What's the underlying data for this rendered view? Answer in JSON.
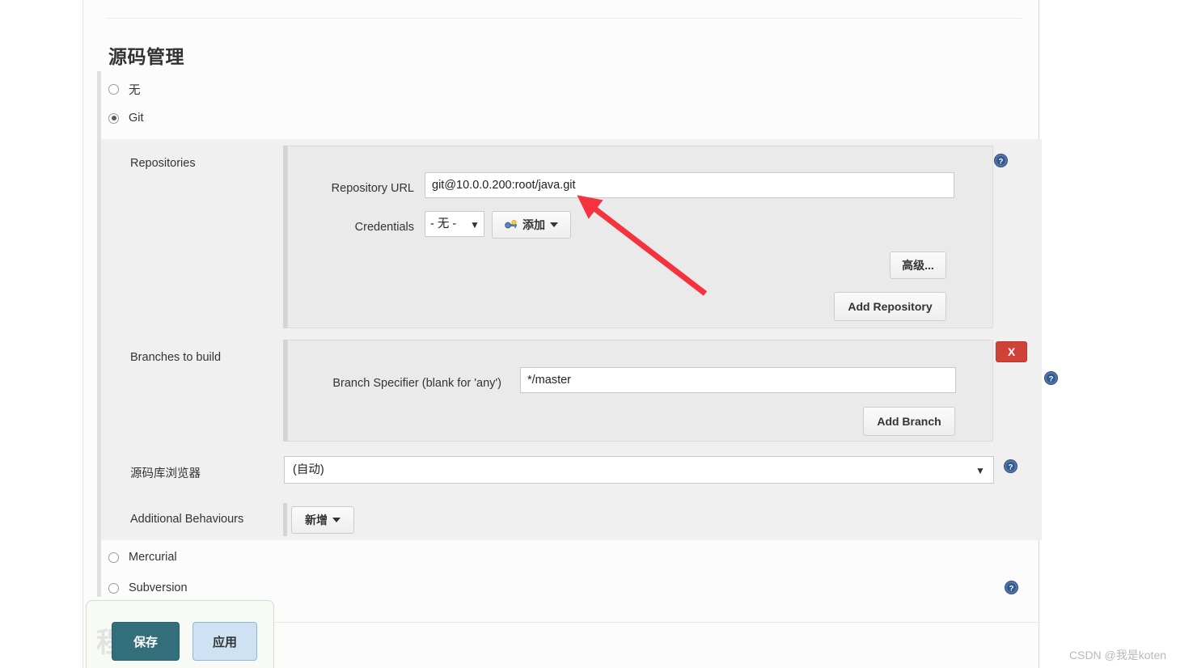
{
  "page": {
    "title": "源码管理",
    "watermark": "CSDN @我是koten"
  },
  "scm_options": [
    {
      "label": "无",
      "checked": false
    },
    {
      "label": "Git",
      "checked": true
    },
    {
      "label": "Mercurial",
      "checked": false
    },
    {
      "label": "Subversion",
      "checked": false
    }
  ],
  "git": {
    "repositories": {
      "label": "Repositories",
      "repository_url": {
        "label": "Repository URL",
        "value": "git@10.0.0.200:root/java.git"
      },
      "credentials": {
        "label": "Credentials",
        "selected": "- 无 -",
        "options": [
          "- 无 -"
        ],
        "add_button": "添加"
      },
      "advanced_button": "高级...",
      "add_repository_button": "Add Repository"
    },
    "branches": {
      "label": "Branches to build",
      "branch_specifier": {
        "label": "Branch Specifier (blank for 'any')",
        "value": "*/master"
      },
      "delete_button": "X",
      "add_branch_button": "Add Branch"
    },
    "repo_browser": {
      "label": "源码库浏览器",
      "selected": "(自动)",
      "options": [
        "(自动)"
      ]
    },
    "additional_behaviours": {
      "label": "Additional Behaviours",
      "add_button": "新增"
    }
  },
  "footer": {
    "save_button": "保存",
    "apply_button": "应用",
    "background_text": "程序文"
  },
  "colors": {
    "save_bg": "#336e7b",
    "apply_bg": "#cfe2f3",
    "delete_bg": "#cf4238",
    "annotation_arrow": "#f5333f",
    "help_icon": "#3f6aa8"
  }
}
